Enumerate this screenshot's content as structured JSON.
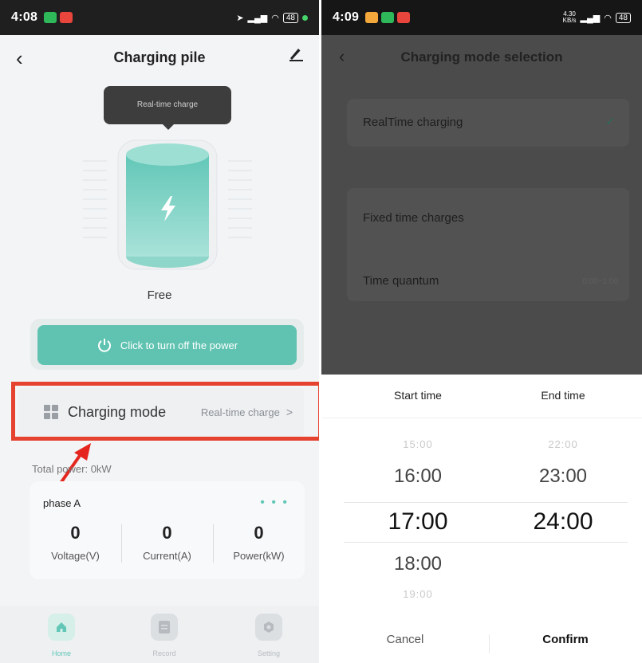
{
  "left": {
    "status": {
      "time": "4:08",
      "battery": "48"
    },
    "header": {
      "title": "Charging pile",
      "back_icon": "back-chevron-icon",
      "edit_icon": "edit-icon"
    },
    "tooltip": "Real-time charge",
    "battery_status": "Free",
    "power_button_label": "Click to turn off the power",
    "charging_mode": {
      "label": "Charging mode",
      "value": "Real-time charge",
      "chevron": ">"
    },
    "total_power": "Total power: 0kW",
    "phase": {
      "title": "phase A",
      "metrics": [
        {
          "value": "0",
          "label": "Voltage(V)"
        },
        {
          "value": "0",
          "label": "Current(A)"
        },
        {
          "value": "0",
          "label": "Power(kW)"
        }
      ]
    },
    "tabs": [
      {
        "label": "Home",
        "icon": "home-icon",
        "active": true
      },
      {
        "label": "Record",
        "icon": "record-icon",
        "active": false
      },
      {
        "label": "Setting",
        "icon": "setting-icon",
        "active": false
      }
    ],
    "accent_color": "#60c3b1",
    "highlight_color": "#e5432f"
  },
  "right": {
    "status": {
      "time": "4:09",
      "net_speed": "4.30",
      "net_unit": "KB/s",
      "battery": "48"
    },
    "header": {
      "title": "Charging mode selection"
    },
    "options": {
      "realtime": "RealTime charging",
      "fixed": "Fixed time charges",
      "quantum_label": "Time quantum",
      "quantum_value": "0:00~1:00"
    },
    "picker": {
      "start_header": "Start time",
      "end_header": "End time",
      "start": [
        "15:00",
        "16:00",
        "17:00",
        "18:00",
        "19:00"
      ],
      "end": [
        "22:00",
        "23:00",
        "24:00"
      ],
      "cancel": "Cancel",
      "confirm": "Confirm"
    }
  }
}
